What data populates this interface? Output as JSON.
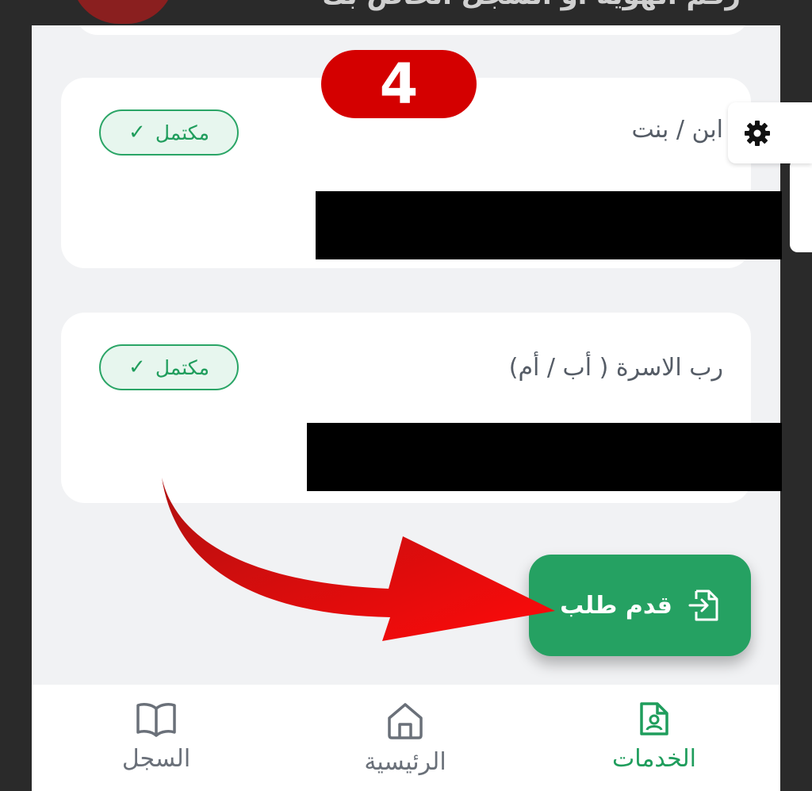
{
  "caption": "رقم الهوية او السجل الخاص بك",
  "step_number": "4",
  "cards": [
    {
      "title": "ابن / بنت",
      "badge": "مكتمل"
    },
    {
      "title": "رب الاسرة ( أب / أم)",
      "badge": "مكتمل"
    }
  ],
  "fab": {
    "label": "قدم طلب",
    "icon": "file-import-icon"
  },
  "nav": {
    "items": [
      {
        "label": "السجل",
        "icon": "book-icon",
        "active": false
      },
      {
        "label": "الرئيسية",
        "icon": "home-icon",
        "active": false
      },
      {
        "label": "الخدمات",
        "icon": "file-user-icon",
        "active": true
      }
    ]
  },
  "settings_icon": "gear-icon",
  "colors": {
    "primary_green": "#25a162",
    "badge_bg": "#e7f6ee",
    "annotation_red": "#d40000",
    "screen_bg": "#f1f2f4"
  }
}
